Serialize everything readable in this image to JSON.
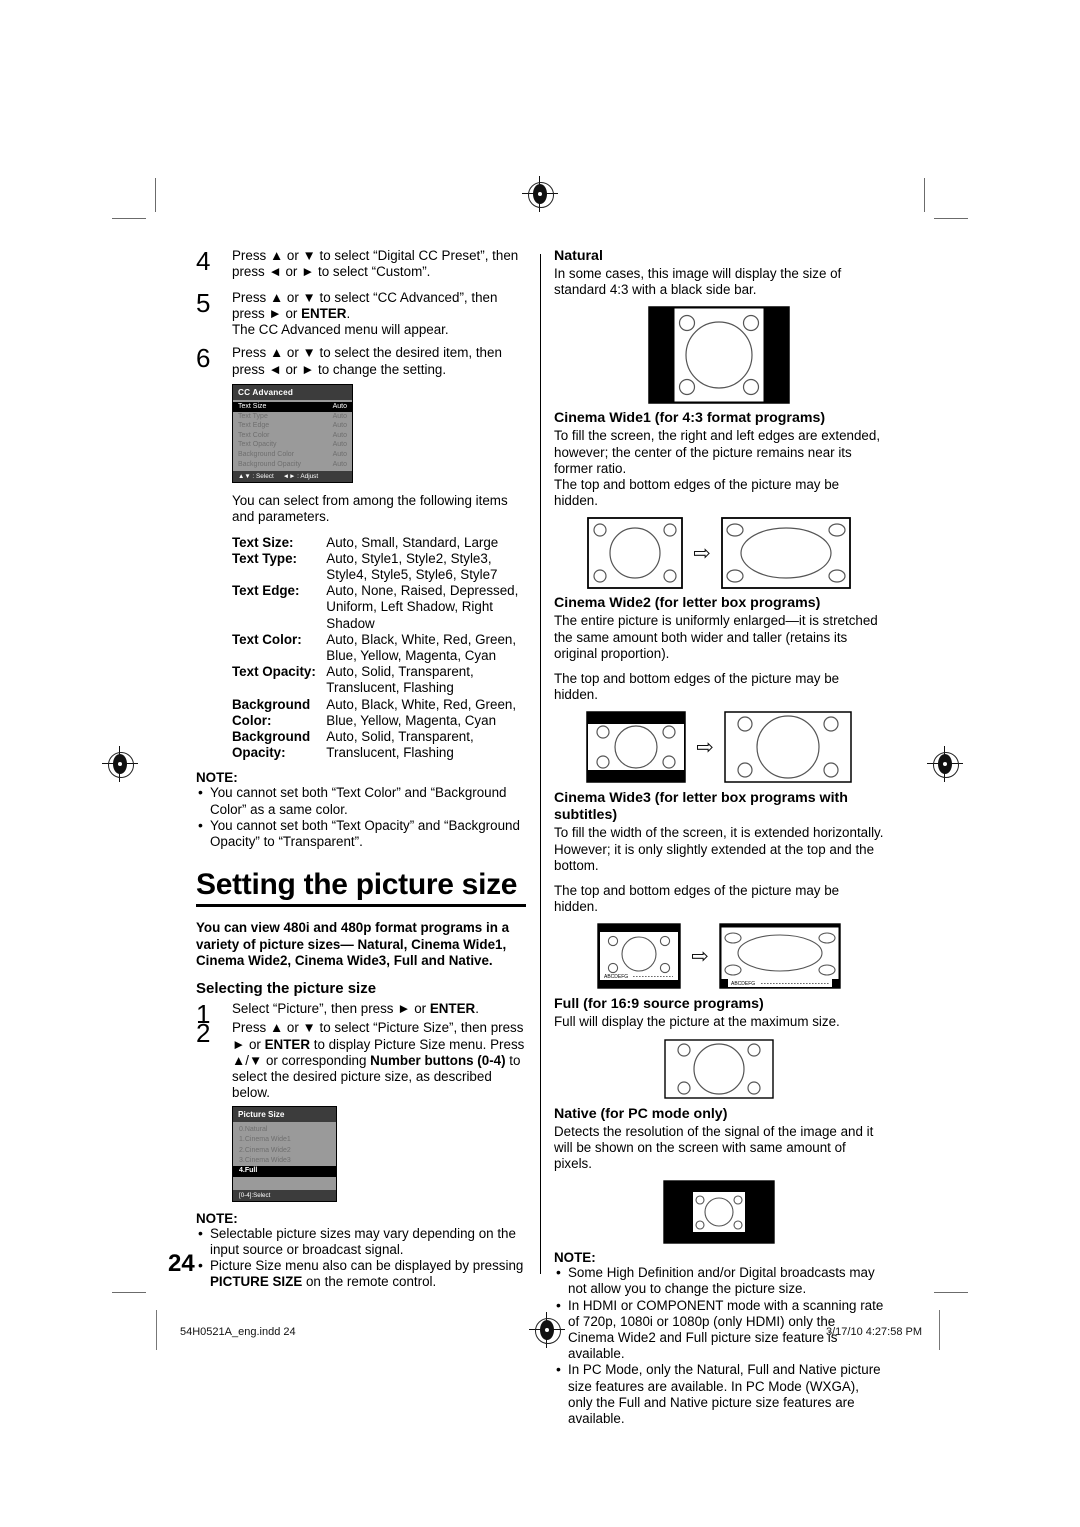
{
  "page": {
    "number": "24",
    "footer_left": "54H0521A_eng.indd   24",
    "footer_right": "3/17/10   4:27:58 PM"
  },
  "left_column": {
    "steps": [
      {
        "num": "4",
        "lines": [
          "Press ▲ or ▼ to select “Digital CC Preset”, then",
          "press ◄ or ► to select “Custom”."
        ]
      },
      {
        "num": "5",
        "lines": [
          "Press ▲ or ▼ to select  “CC Advanced”, then",
          "press ► or ENTER.",
          "The CC Advanced menu will appear."
        ]
      },
      {
        "num": "6",
        "lines": [
          "Press ▲ or ▼ to select the desired item, then",
          "press ◄ or ► to change the setting."
        ]
      }
    ],
    "step4_text_a": "Press ▲ or ▼ to select “Digital CC Preset”, then press ◄ or ► to select “Custom”.",
    "step5_text_a": "Press ▲ or ▼ to select  “CC Advanced”, then press ► or ",
    "step5_bold": "ENTER",
    "step5_text_b": ".",
    "step5_text_c": "The CC Advanced menu will appear.",
    "step6_text_a": "Press ▲ or ▼ to select the desired item, then press ◄ or ► to change the setting.",
    "cc_menu": {
      "title": "CC Advanced",
      "rows": [
        {
          "label": "Text Size",
          "value": "Auto",
          "selected": true
        },
        {
          "label": "Text Type",
          "value": "Auto",
          "selected": false
        },
        {
          "label": "Text Edge",
          "value": "Auto",
          "selected": false
        },
        {
          "label": "Text Color",
          "value": "Auto",
          "selected": false
        },
        {
          "label": "Text Opacity",
          "value": "Auto",
          "selected": false
        },
        {
          "label": "Background Color",
          "value": "Auto",
          "selected": false
        },
        {
          "label": "Background Opacity",
          "value": "Auto",
          "selected": false
        }
      ],
      "footer_select": "▲▼ : Select",
      "footer_adjust": "◄► : Adjust"
    },
    "intro": "You can select from among the following items and parameters.",
    "params": [
      {
        "key": "Text Size:",
        "value": "Auto, Small, Standard, Large"
      },
      {
        "key": "Text Type:",
        "value": "Auto, Style1, Style2, Style3, Style4, Style5, Style6, Style7"
      },
      {
        "key": "Text Edge:",
        "value": "Auto, None, Raised, Depressed, Uniform, Left Shadow, Right Shadow"
      },
      {
        "key": "Text Color:",
        "value": "Auto, Black, White, Red, Green, Blue, Yellow, Magenta, Cyan"
      },
      {
        "key": "Text Opacity:",
        "value": "Auto, Solid, Transparent, Translucent, Flashing"
      },
      {
        "key": "Background Color:",
        "value": "Auto, Black, White, Red, Green, Blue, Yellow, Magenta, Cyan"
      },
      {
        "key": "Background Opacity:",
        "value": "Auto, Solid, Transparent, Translucent, Flashing"
      }
    ],
    "note1": {
      "heading": "NOTE:",
      "items": [
        "You cannot set both “Text Color” and “Background Color” as a same color.",
        "You cannot set both “Text Opacity” and “Background Opacity” to “Transparent”."
      ]
    },
    "heading": "Setting the picture size",
    "leadin": "You can view 480i and 480p format programs in a variety of picture sizes— Natural, Cinema Wide1, Cinema Wide2, Cinema Wide3, Full and Native.",
    "subheading": "Selecting the picture size",
    "step1_a": "Select “Picture”, then press ► or ",
    "step1_bold": "ENTER",
    "step1_b": ".",
    "step2_a": "Press ▲ or ▼ to select “Picture Size”, then press ► or ",
    "step2_b": "ENTER",
    "step2_c": " to display Picture Size menu. Press ▲/▼ or corresponding ",
    "step2_d": "Number buttons (0-4)",
    "step2_e": " to select the desired picture size, as described below.",
    "ps_menu": {
      "title": "Picture Size",
      "rows": [
        {
          "label": "0.Natural",
          "selected": false
        },
        {
          "label": "1.Cinema Wide1",
          "selected": false
        },
        {
          "label": "2.Cinema Wide2",
          "selected": false
        },
        {
          "label": "3.Cinema Wide3",
          "selected": false
        },
        {
          "label": "4.Full",
          "selected": true
        }
      ],
      "footer": "[0-4]:Select"
    },
    "note2": {
      "heading": "NOTE:",
      "items": [
        "Selectable picture sizes may vary depending on the input source or broadcast signal.",
        "Picture Size menu also can be displayed by pressing PICTURE SIZE on the remote control."
      ],
      "item2_a": "Picture Size menu also can be displayed by pressing ",
      "item2_bold": "PICTURE SIZE",
      "item2_b": " on the remote control."
    }
  },
  "right_column": {
    "sections": [
      {
        "title": "Natural",
        "body": "In some cases, this image will display the size of standard 4:3 with a black side bar."
      },
      {
        "title": "Cinema Wide1 (for 4:3 format programs)",
        "body": "To fill the screen, the right and left edges are extended, however; the center of the picture remains near its former ratio.",
        "body2": "The top and bottom edges of the picture may be hidden."
      },
      {
        "title": "Cinema Wide2 (for letter box programs)",
        "body": "The entire picture is uniformly enlarged—it is stretched the same amount both wider and taller (retains its original proportion).",
        "body2": "The top and bottom edges of the picture may be hidden."
      },
      {
        "title": "Cinema Wide3 (for letter box programs with subtitles)",
        "body": "To fill the width of the screen, it is extended horizontally. However; it is only slightly extended at the top and the bottom.",
        "body2": "The top and bottom edges of the picture may be hidden."
      },
      {
        "title": "Full (for 16:9 source programs)",
        "body": "Full will display the picture at the maximum size."
      },
      {
        "title": "Native (for PC mode only)",
        "body": "Detects the resolution of the signal of the image and it will be shown on the screen with same amount of pixels."
      }
    ],
    "subtitle_sample": "ABCDEFG",
    "note": {
      "heading": "NOTE:",
      "items": [
        "Some High Definition and/or Digital broadcasts may not allow you to change the picture size.",
        "In HDMI or COMPONENT mode with a scanning rate of 720p, 1080i or 1080p (only HDMI) only the Cinema Wide2 and Full picture size feature is available.",
        "In PC Mode, only the Natural, Full and Native picture size features are available. In PC Mode (WXGA), only the Full and Native picture size features are available."
      ]
    }
  }
}
